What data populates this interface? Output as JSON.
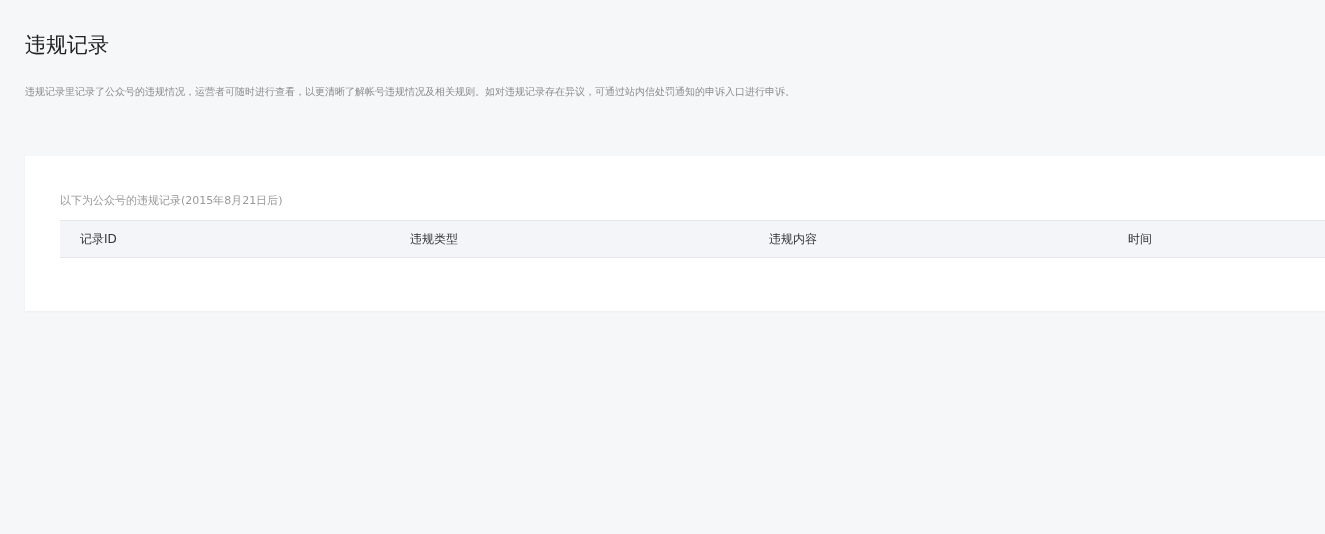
{
  "page": {
    "title": "违规记录",
    "description": "违规记录里记录了公众号的违规情况，运营者可随时进行查看，以更清晰了解帐号违规情况及相关规则。如对违规记录存在异议，可通过站内信处罚通知的申诉入口进行申诉。"
  },
  "card": {
    "caption": "以下为公众号的违规记录(2015年8月21日后)",
    "table": {
      "columns": [
        "记录ID",
        "违规类型",
        "违规内容",
        "时间"
      ]
    }
  }
}
